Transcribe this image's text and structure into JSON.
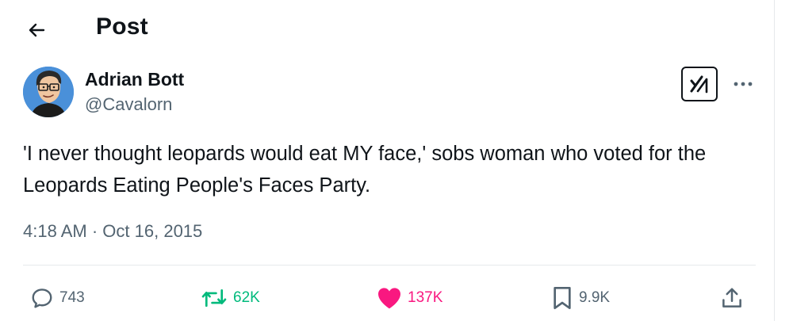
{
  "header": {
    "title": "Post",
    "back_icon": "arrow-left-icon"
  },
  "author": {
    "display_name": "Adrian Bott",
    "handle": "@Cavalorn",
    "avatar": "cartoon-portrait-with-glasses"
  },
  "post": {
    "text": "'I never thought leopards would eat MY face,' sobs woman who voted for the Leopards Eating People's Faces Party.",
    "time": "4:18 AM",
    "separator": "·",
    "date": "Oct 16, 2015"
  },
  "actions": {
    "replies": "743",
    "reposts": "62K",
    "likes": "137K",
    "bookmarks": "9.9K",
    "liked": true
  },
  "colors": {
    "text_primary": "#0f1419",
    "text_secondary": "#536471",
    "repost_green": "#00ba7c",
    "like_pink": "#f91880",
    "divider": "#e6e9ec"
  },
  "icons": {
    "top_right": [
      "grok-icon",
      "more-dots-icon"
    ],
    "action_bar": [
      "reply-icon",
      "repost-icon",
      "heart-icon",
      "bookmark-icon",
      "share-icon"
    ]
  }
}
